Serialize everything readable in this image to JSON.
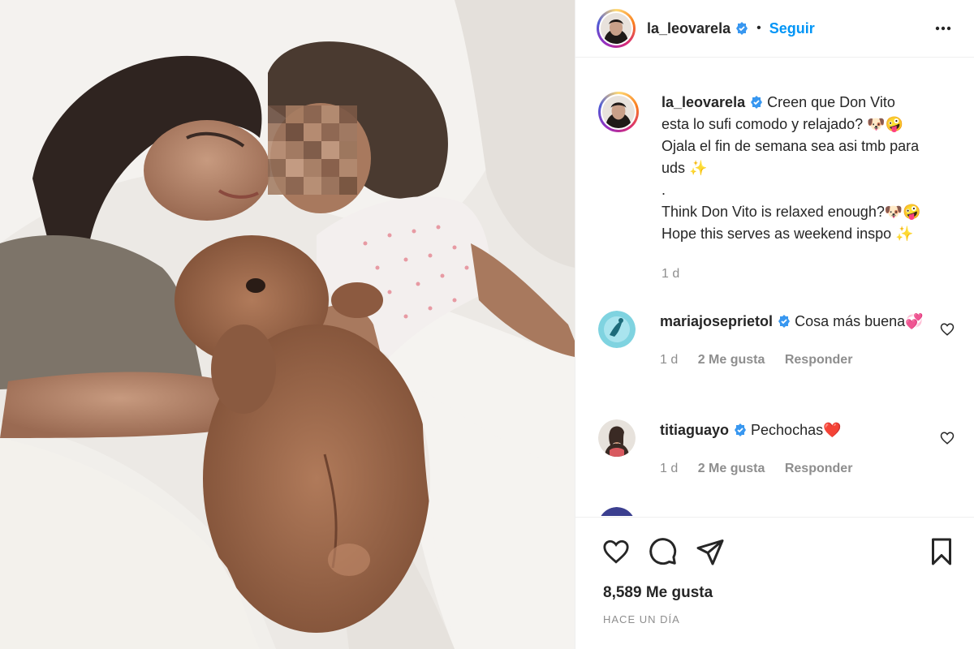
{
  "post": {
    "username": "la_leovarela",
    "follow_label": "Seguir",
    "caption_lines": [
      "Creen que Don Vito",
      "esta lo sufi comodo y relajado? 🐶🤪",
      "Ojala el fin de semana sea asi tmb para",
      "uds ✨",
      ".",
      "Think Don Vito is relaxed enough?🐶🤪",
      "Hope this serves as weekend inspo ✨"
    ],
    "caption_age": "1 d"
  },
  "comments": [
    {
      "username": "mariajoseprietol",
      "text": "Cosa más buena💞",
      "age": "1 d",
      "likes": "2 Me gusta",
      "reply": "Responder"
    },
    {
      "username": "titiaguayo",
      "text": "Pechochas❤️",
      "age": "1 d",
      "likes": "2 Me gusta",
      "reply": "Responder"
    }
  ],
  "footer": {
    "likes": "8,589 Me gusta",
    "timestamp": "HACE UN DÍA"
  },
  "icons": {
    "verified": "verified-badge-icon",
    "more": "more-options-icon",
    "like": "heart-icon",
    "comment": "comment-icon",
    "share": "share-icon",
    "save": "bookmark-icon"
  },
  "colors": {
    "accent": "#0095f6",
    "verified": "#3897f0",
    "muted": "#8e8e8e"
  }
}
